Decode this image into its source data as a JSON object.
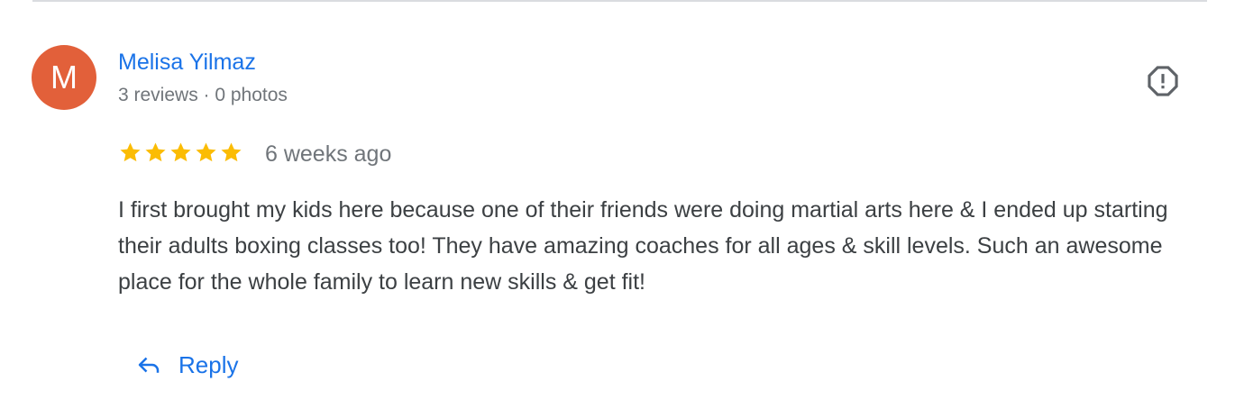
{
  "review": {
    "author": {
      "initial": "M",
      "name": "Melisa Yilmaz",
      "meta": "3 reviews · 0 photos",
      "avatar_color": "#e2603a"
    },
    "rating": 5,
    "rating_max": 5,
    "date": "6 weeks ago",
    "text": "I first brought my kids here because one of their friends were doing martial arts here & I ended up starting their adults boxing classes too! They have amazing coaches for all ages & skill levels. Such an awesome place for the whole family to learn new skills & get fit!",
    "actions": {
      "reply_label": "Reply",
      "reply_icon": "reply-arrow-icon",
      "flag_icon": "report-flag-icon"
    }
  },
  "colors": {
    "link_blue": "#1a73e8",
    "star_gold": "#fbbc04",
    "meta_gray": "#70757a",
    "text_dark": "#3c4043"
  }
}
